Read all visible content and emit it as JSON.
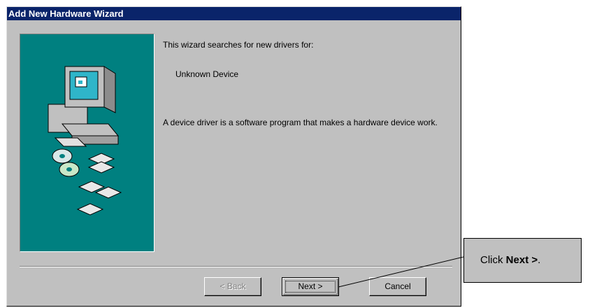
{
  "window": {
    "title": "Add New Hardware Wizard"
  },
  "content": {
    "intro": "This wizard searches for new drivers for:",
    "device": "Unknown Device",
    "description": "A device driver is a software program that makes a hardware device work."
  },
  "buttons": {
    "back": "< Back",
    "next": "Next >",
    "cancel": "Cancel"
  },
  "callout": {
    "prefix": "Click ",
    "bold": "Next >",
    "suffix": "."
  },
  "colors": {
    "titlebar": "#0a246a",
    "art_bg": "#008080",
    "face": "#c0c0c0"
  },
  "icons": [
    "computer-icon",
    "cd-icon",
    "floppy-disk-icon"
  ]
}
